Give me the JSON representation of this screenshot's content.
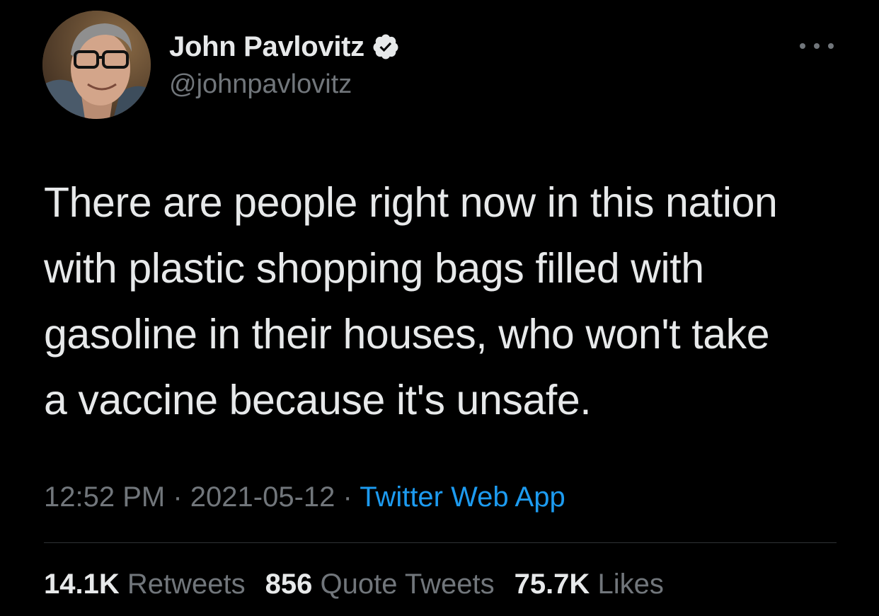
{
  "author": {
    "name": "John Pavlovitz",
    "handle": "@johnpavlovitz",
    "verified_icon": "verified-badge-icon",
    "avatar_icon": "profile-photo"
  },
  "tweet": {
    "text": "There are people right now in this nation\nwith plastic shopping bags filled with\ngasoline in their houses, who won't take\na vaccine because it's unsafe."
  },
  "meta": {
    "time": "12:52 PM",
    "separator": " · ",
    "date": "2021-05-12",
    "source": "Twitter Web App"
  },
  "stats": {
    "retweets_count": "14.1K",
    "retweets_label": "Retweets",
    "quotes_count": "856",
    "quotes_label": "Quote Tweets",
    "likes_count": "75.7K",
    "likes_label": "Likes"
  },
  "colors": {
    "background": "#000000",
    "text": "#e7e9ea",
    "secondary": "#71767b",
    "link": "#1d9bf0",
    "divider": "#2f3336"
  }
}
